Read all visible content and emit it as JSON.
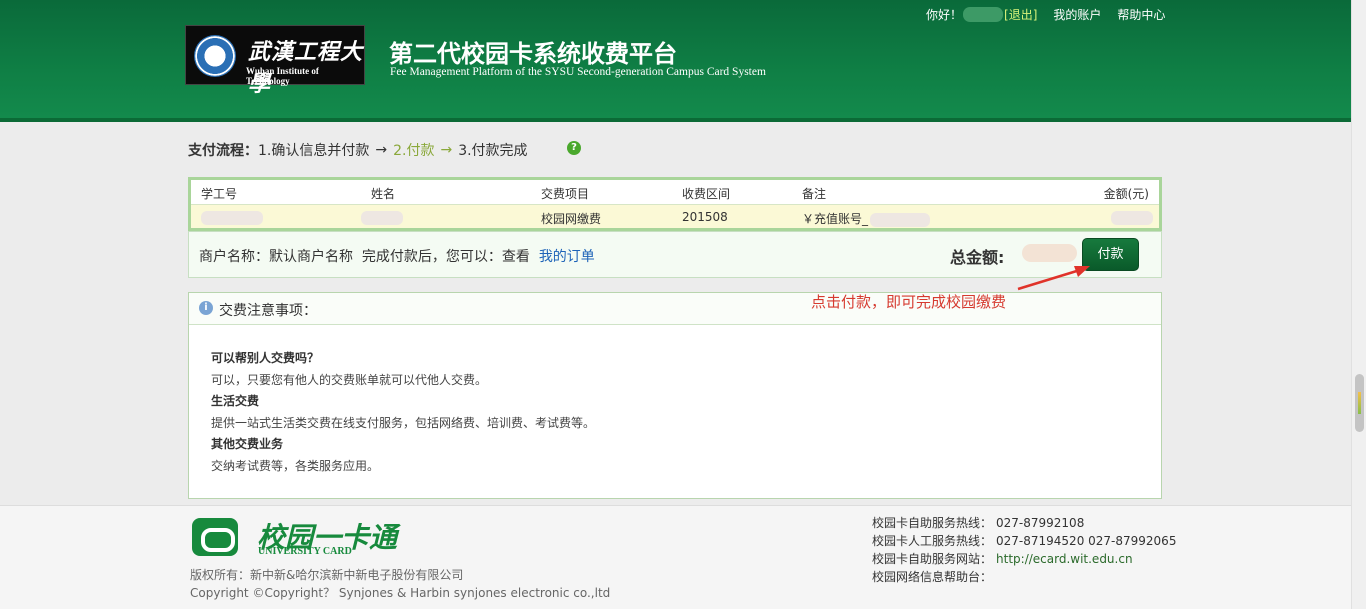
{
  "header": {
    "logo_cn": "武漢工程大學",
    "logo_en": "Wuhan Institute of Technology",
    "title_cn": "第二代校园卡系统收费平台",
    "title_en": "Fee Management Platform of the SYSU Second-generation Campus Card System",
    "greeting": "你好！",
    "logout": "[退出]",
    "my_account": "我的账户",
    "help_center": "帮助中心"
  },
  "flow": {
    "label": "支付流程：",
    "steps": [
      "1.确认信息并付款",
      "2.付款",
      "3.付款完成"
    ],
    "arrow": "→",
    "active_step": 2
  },
  "table": {
    "headers": [
      "学工号",
      "姓名",
      "交费项目",
      "收费区间",
      "备注",
      "金额(元)"
    ],
    "row": {
      "item": "校园网缴费",
      "period": "201508",
      "remark": "￥充值账号_"
    }
  },
  "merchant": {
    "label": "商户名称：默认商户名称",
    "after_pay": "完成付款后，您可以：查看",
    "orders_link": "我的订单",
    "total_label": "总金额:",
    "pay_button": "付款"
  },
  "annotation": "点击付款，即可完成校园缴费",
  "notice": {
    "title": "交费注意事项：",
    "faqs": [
      {
        "q": "可以帮别人交费吗？",
        "a": "可以，只要您有他人的交费账单就可以代他人交费。"
      },
      {
        "q": "生活交费",
        "a": "提供一站式生活类交费在线支付服务，包括网络费、培训费、考试费等。"
      },
      {
        "q": "其他交费业务",
        "a": "交纳考试费等，各类服务应用。"
      }
    ]
  },
  "footer": {
    "card_name": "校园一卡通",
    "card_en": "UNIVERSITY CARD",
    "copyright_1": "版权所有：新中新&哈尔滨新中新电子股份有限公司",
    "copyright_2": "Copyright ©Copyright？ Synjones & Harbin synjones electronic co.,ltd",
    "hotlines": [
      {
        "label": "校园卡自助服务热线：",
        "value": "027-87992108"
      },
      {
        "label": "校园卡人工服务热线：",
        "value": "027-87194520 027-87992065"
      },
      {
        "label": "校园卡自助服务网站：",
        "value": "http://ecard.wit.edu.cn"
      },
      {
        "label": "校园网络信息帮助台：",
        "value": ""
      }
    ]
  },
  "colors": {
    "header_green": "#0f7f45",
    "active_step": "#8aa83a",
    "annotation_red": "#d63a2f",
    "link_blue": "#1e63b8"
  }
}
